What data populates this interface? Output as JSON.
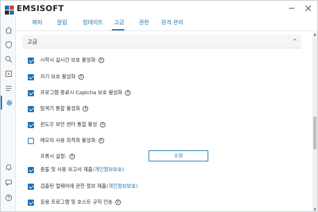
{
  "app": {
    "brand": "EMSISOFT",
    "window_controls": {
      "minimize_glyph": "—",
      "close_glyph": "✕"
    }
  },
  "sidebar": {
    "items": [
      {
        "icon": "home-icon"
      },
      {
        "icon": "shield-icon"
      },
      {
        "icon": "search-icon"
      },
      {
        "icon": "quarantine-icon"
      },
      {
        "icon": "logs-icon"
      },
      {
        "icon": "gear-icon",
        "active": true
      }
    ],
    "bottom_items": [
      {
        "icon": "bell-icon"
      },
      {
        "icon": "chat-icon"
      },
      {
        "icon": "help-icon"
      }
    ]
  },
  "tabs": [
    {
      "label": "제외"
    },
    {
      "label": "알림"
    },
    {
      "label": "업데이트"
    },
    {
      "label": "고급",
      "active": true
    },
    {
      "label": "권한"
    },
    {
      "label": "원격 관리"
    }
  ],
  "section": {
    "title": "고급",
    "chevron": "^"
  },
  "options": [
    {
      "label": "시작시 실시간 보호 활성화",
      "checked": true,
      "info": true
    },
    {
      "label": "자기 보호 활성화",
      "checked": true,
      "info": true
    },
    {
      "label": "프로그램 종료시 Captcha 보호 활성화",
      "checked": true,
      "info": true
    },
    {
      "label": "탐색기 통합 활성화",
      "checked": true,
      "info": true
    },
    {
      "label": "윈도우 보안 센터 통합 활성",
      "checked": true,
      "info": true
    },
    {
      "label": "메모리 사용 최적화 활성화",
      "checked": false,
      "info": true
    }
  ],
  "proxy": {
    "label": "프록시 설정:",
    "button": "수정"
  },
  "options2": [
    {
      "label": "충돌 및 사용 보고서 제출 ",
      "link": "(개인정보보호)",
      "checked": true
    },
    {
      "label": "검출된 멀웨어에 관한 정보 제출 ",
      "link": "(개인정보보호)",
      "checked": true
    },
    {
      "label": "응용 프로그램 및 호스트 규칙 전송",
      "checked": true,
      "info": true
    }
  ],
  "info_glyph": "i",
  "colors": {
    "accent": "#1f6fb0",
    "link": "#1f6fa8"
  }
}
